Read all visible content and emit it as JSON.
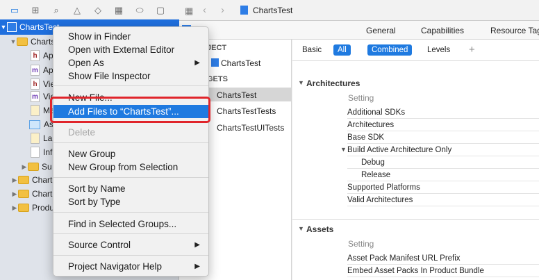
{
  "navigator": {
    "toolbar_icons": [
      "folder-icon",
      "hierarchy-icon",
      "magnifier-icon",
      "warning-icon",
      "diamond-icon",
      "grid-icon",
      "tag-icon",
      "comment-icon"
    ],
    "items": [
      {
        "label": "ChartsTest",
        "icon": "project-icon",
        "kind": "project"
      },
      {
        "label": "Charts",
        "icon": "folder-icon",
        "kind": "folder"
      },
      {
        "label": "Ap",
        "icon": "header-file-icon",
        "kind": "h"
      },
      {
        "label": "Ap",
        "icon": "source-file-icon",
        "kind": "m"
      },
      {
        "label": "Vie",
        "icon": "header-file-icon",
        "kind": "h"
      },
      {
        "label": "Vie",
        "icon": "source-file-icon",
        "kind": "m"
      },
      {
        "label": "Ma",
        "icon": "storyboard-icon",
        "kind": "sb"
      },
      {
        "label": "As",
        "icon": "assets-icon",
        "kind": "as"
      },
      {
        "label": "La",
        "icon": "storyboard-icon",
        "kind": "sb"
      },
      {
        "label": "Inf",
        "icon": "plist-icon",
        "kind": "pl"
      },
      {
        "label": "Su",
        "icon": "folder-icon",
        "kind": "folder"
      },
      {
        "label": "Chart",
        "icon": "folder-icon",
        "kind": "folder"
      },
      {
        "label": "Chart",
        "icon": "folder-icon",
        "kind": "folder"
      },
      {
        "label": "Produ",
        "icon": "folder-icon",
        "kind": "folder"
      }
    ]
  },
  "editor": {
    "breadcrumb": "ChartsTest",
    "tabs": [
      "General",
      "Capabilities",
      "Resource Tag"
    ],
    "targets": {
      "project_header": "JECT",
      "project_item": "ChartsTest",
      "targets_header": "GETS",
      "items": [
        "ChartsTest",
        "ChartsTestTests",
        "ChartsTestUITests"
      ]
    },
    "filter": {
      "basic": "Basic",
      "all": "All",
      "combined": "Combined",
      "levels": "Levels",
      "add": "+"
    },
    "sections": [
      {
        "title": "Architectures",
        "column_header": "Setting",
        "rows": [
          "Additional SDKs",
          "Architectures",
          "Base SDK",
          "Build Active Architecture Only",
          "Debug",
          "Release",
          "Supported Platforms",
          "Valid Architectures"
        ]
      },
      {
        "title": "Assets",
        "column_header": "Setting",
        "rows": [
          "Asset Pack Manifest URL Prefix",
          "Embed Asset Packs In Product Bundle"
        ]
      }
    ]
  },
  "context_menu": {
    "items": [
      {
        "label": "Show in Finder",
        "state": "normal"
      },
      {
        "label": "Open with External Editor",
        "state": "normal"
      },
      {
        "label": "Open As",
        "state": "normal",
        "submenu": true
      },
      {
        "label": "Show File Inspector",
        "state": "normal"
      },
      {
        "label": "New File...",
        "state": "normal"
      },
      {
        "label": "Add Files to “ChartsTest”...",
        "state": "highlighted"
      },
      {
        "label": "Delete",
        "state": "disabled"
      },
      {
        "label": "New Group",
        "state": "normal"
      },
      {
        "label": "New Group from Selection",
        "state": "normal"
      },
      {
        "label": "Sort by Name",
        "state": "normal"
      },
      {
        "label": "Sort by Type",
        "state": "normal"
      },
      {
        "label": "Find in Selected Groups...",
        "state": "normal"
      },
      {
        "label": "Source Control",
        "state": "normal",
        "submenu": true
      },
      {
        "label": "Project Navigator Help",
        "state": "normal",
        "submenu": true
      }
    ],
    "submenu_glyph": "▶"
  },
  "colors": {
    "accent": "#1f7ae0",
    "annotation": "#e0252b"
  }
}
